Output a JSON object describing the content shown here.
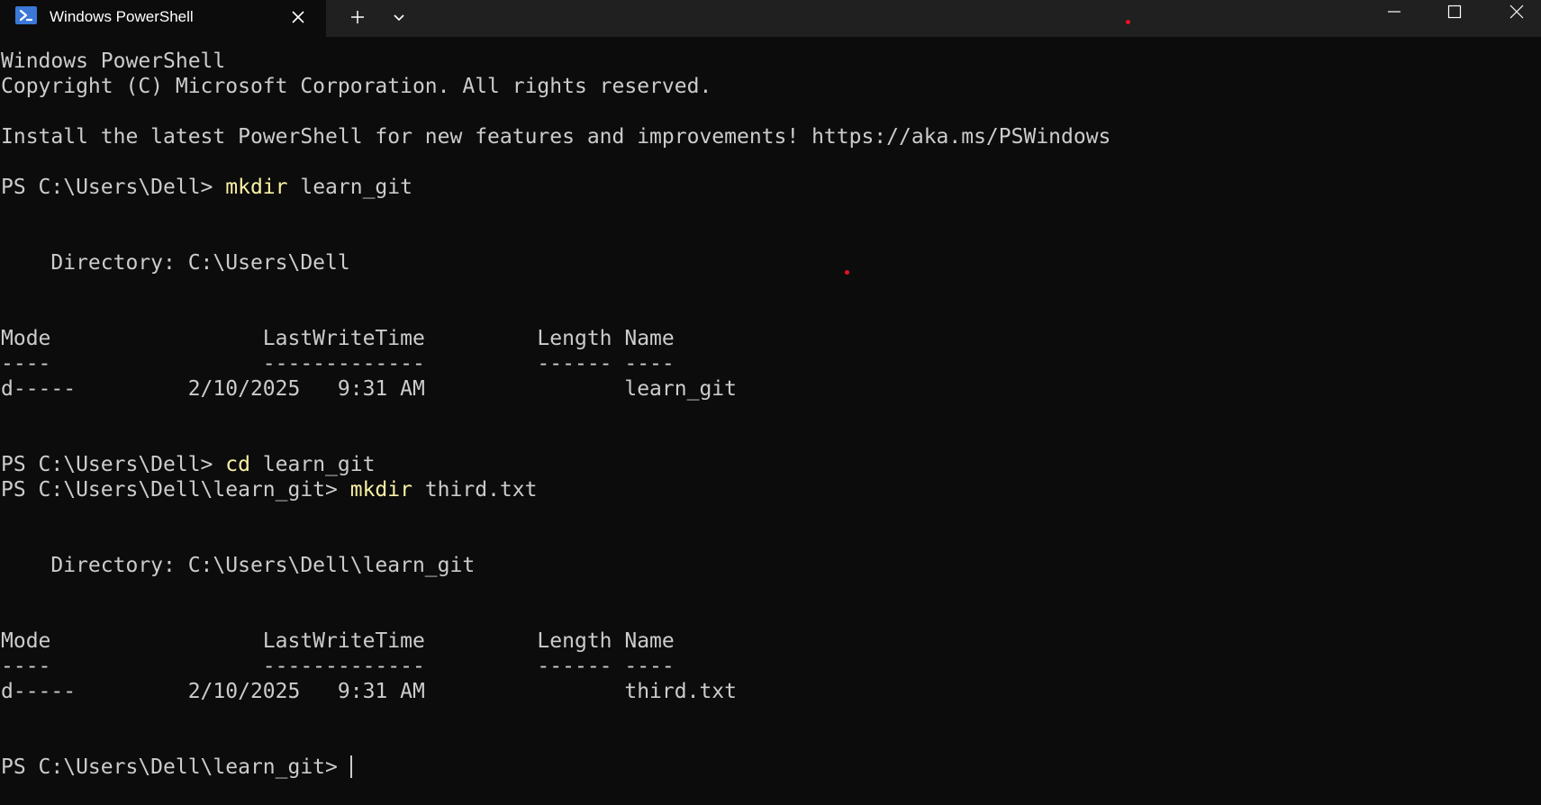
{
  "window": {
    "tab_title": "Windows PowerShell",
    "icons": {
      "tab": "powershell-icon",
      "tab_close": "close-icon",
      "new_tab": "plus-icon",
      "dropdown": "chevron-down-icon",
      "minimize": "minimize-icon",
      "maximize": "maximize-icon",
      "close": "close-icon"
    }
  },
  "colors": {
    "background": "#0c0c0c",
    "titlebar": "#202020",
    "text": "#cccccc",
    "command": "#f9f1a5"
  },
  "terminal": {
    "header_line1": "Windows PowerShell",
    "header_line2": "Copyright (C) Microsoft Corporation. All rights reserved.",
    "install_msg": "Install the latest PowerShell for new features and improvements! https://aka.ms/PSWindows",
    "block1": {
      "prompt": "PS C:\\Users\\Dell> ",
      "command": "mkdir",
      "args": " learn_git",
      "directory": "    Directory: C:\\Users\\Dell",
      "table_header": "Mode                 LastWriteTime         Length Name",
      "table_sep": "----                 -------------         ------ ----",
      "table_row": "d-----         2/10/2025   9:31 AM                learn_git"
    },
    "block2": {
      "prompt": "PS C:\\Users\\Dell> ",
      "command": "cd",
      "args": " learn_git"
    },
    "block3": {
      "prompt": "PS C:\\Users\\Dell\\learn_git> ",
      "command": "mkdir",
      "args": " third.txt",
      "directory": "    Directory: C:\\Users\\Dell\\learn_git",
      "table_header": "Mode                 LastWriteTime         Length Name",
      "table_sep": "----                 -------------         ------ ----",
      "table_row": "d-----         2/10/2025   9:31 AM                third.txt"
    },
    "final_prompt": "PS C:\\Users\\Dell\\learn_git> "
  }
}
